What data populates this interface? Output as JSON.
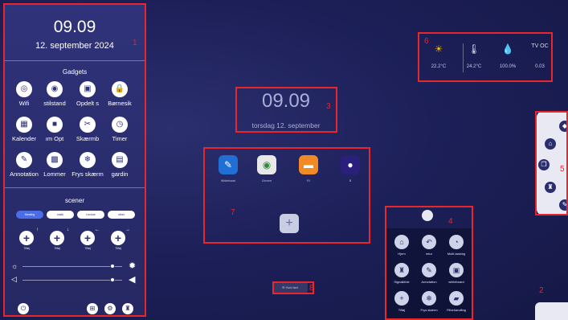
{
  "left_panel": {
    "time": "09.09",
    "date": "12. september 2024",
    "gadgets_title": "Gadgets",
    "gadgets": [
      {
        "icon": "wifi-icon",
        "glyph": "◎",
        "label": "Wifi"
      },
      {
        "icon": "eye-icon",
        "glyph": "◉",
        "label": "stilstand"
      },
      {
        "icon": "split-screen-icon",
        "glyph": "▣",
        "label": "Opdelt s"
      },
      {
        "icon": "child-lock-icon",
        "glyph": "🔒",
        "label": "Børnesik"
      },
      {
        "icon": "calendar-icon",
        "glyph": "▦",
        "label": "Kalender"
      },
      {
        "icon": "camera-icon",
        "glyph": "■",
        "label": "ım Opt"
      },
      {
        "icon": "scissors-icon",
        "glyph": "✂",
        "label": "Skærmb"
      },
      {
        "icon": "timer-icon",
        "glyph": "◷",
        "label": "Timer"
      },
      {
        "icon": "pen-icon",
        "glyph": "✎",
        "label": "Annotation"
      },
      {
        "icon": "grid-icon",
        "glyph": "▩",
        "label": "Lommer"
      },
      {
        "icon": "snowflake-icon",
        "glyph": "❄",
        "label": "Frys skærm"
      },
      {
        "icon": "curtain-icon",
        "glyph": "▤",
        "label": "gardin"
      }
    ],
    "scenes_title": "scener",
    "scene_tabs": [
      "Meeting",
      "matic",
      "Lecture",
      "other"
    ],
    "scenes": [
      {
        "label": "Tilføj",
        "arrow": "↑"
      },
      {
        "label": "Tilføj",
        "arrow": "↓"
      },
      {
        "label": "Tilføj",
        "arrow": "←"
      },
      {
        "label": "Tilføj",
        "arrow": "→"
      }
    ],
    "brightness_icon": "sun-icon",
    "volume_icon": "speaker-icon",
    "brightness_level": 0.9,
    "volume_level": 0.9,
    "bottom_icons": [
      "power-icon",
      "windows-icon",
      "settings-icon",
      "projector-icon"
    ]
  },
  "weather": {
    "items": [
      {
        "icon": "sun-icon",
        "glyph": "☀",
        "value": "22.2°C",
        "color": "#f2b705"
      },
      {
        "icon": "thermometer-icon",
        "glyph": "🌡",
        "value": "24.2°C",
        "color": "#d8dcf0"
      },
      {
        "icon": "droplet-icon",
        "glyph": "💧",
        "value": "100.0%",
        "color": "#d8dcf0"
      },
      {
        "icon": "tvoc-icon",
        "glyph": "TV OC",
        "value": "0.03",
        "color": "#d8dcf0"
      }
    ]
  },
  "center_clock": {
    "time": "09.09",
    "date": "torsdag 12. september"
  },
  "apps": [
    {
      "icon": "whiteboard-app-icon",
      "glyph": "✎",
      "label": "Whiteboard",
      "bg": "#1f6fd6"
    },
    {
      "icon": "chrome-app-icon",
      "glyph": "◉",
      "label": "Chrome",
      "bg": "#e8e8e8"
    },
    {
      "icon": "files-app-icon",
      "glyph": "▬",
      "label": "Fil",
      "bg": "#f08a24"
    },
    {
      "icon": "media-app-icon",
      "glyph": "●",
      "label": "B",
      "bg": "#2a1f7a"
    }
  ],
  "add_app_label": "+",
  "bottom_button": "☰ Hvid tavl",
  "tools": [
    {
      "icon": "home-icon",
      "glyph": "⌂",
      "label": "Hjem"
    },
    {
      "icon": "back-icon",
      "glyph": "↶",
      "label": "retur"
    },
    {
      "icon": "multitask-icon",
      "glyph": "◔",
      "label": "Multi-tasking"
    },
    {
      "icon": "screencast-icon",
      "glyph": "♜",
      "label": "Signalkilde"
    },
    {
      "icon": "annotation-icon",
      "glyph": "✎",
      "label": "Annotation"
    },
    {
      "icon": "whiteboard-icon",
      "glyph": "▣",
      "label": "whiteboard"
    },
    {
      "icon": "add-icon",
      "glyph": "+",
      "label": "Tilføj"
    },
    {
      "icon": "freeze-icon",
      "glyph": "❄",
      "label": "Frys skærm"
    },
    {
      "icon": "folder-icon",
      "glyph": "▰",
      "label": "Filbehandling"
    }
  ],
  "side_toolbar": [
    {
      "icon": "back-arrow-icon",
      "glyph": "◆"
    },
    {
      "icon": "home-icon",
      "glyph": "⌂"
    },
    {
      "icon": "windows-icon",
      "glyph": "❐"
    },
    {
      "icon": "projector-icon",
      "glyph": "♜"
    },
    {
      "icon": "pen-icon",
      "glyph": "✎"
    }
  ],
  "annotations": [
    "1",
    "2",
    "3",
    "4",
    "5",
    "6",
    "7",
    "8"
  ]
}
